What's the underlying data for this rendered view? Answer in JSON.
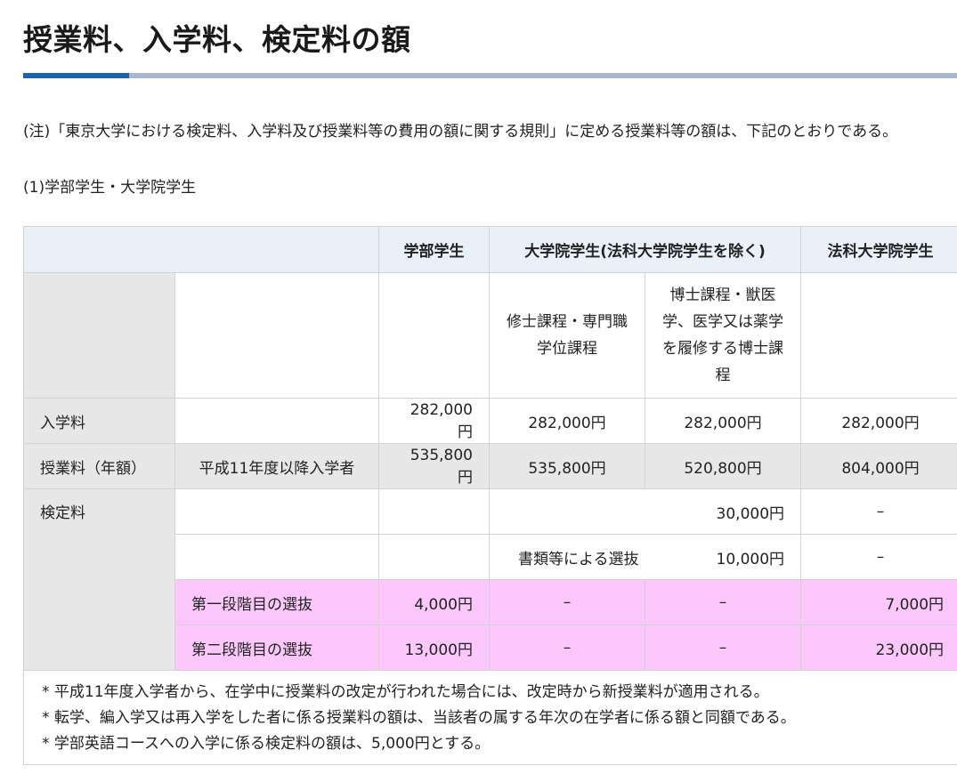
{
  "page": {
    "title": "授業料、入学料、検定料の額",
    "note": "(注)「東京大学における検定料、入学料及び授業料等の費用の額に関する規則」に定める授業料等の額は、下記のとおりである。",
    "section_heading": "(1)学部学生・大学院学生"
  },
  "colors": {
    "accent": "#1f62a6",
    "rule": "#a9b8c9",
    "header_bg": "#e9f0f8",
    "row_header_bg": "#e7e7e7",
    "highlight_bg": "#fcc8fc"
  },
  "table": {
    "headers": {
      "undergrad": "学部学生",
      "grad": "大学院学生(法科大学院学生を除く)",
      "law": "法科大学院学生"
    },
    "subheaders": {
      "masters": "修士課程・専門職学位課程",
      "doctoral": "博士課程・獣医学、医学又は薬学を履修する博士課程"
    },
    "admission": {
      "label": "入学料",
      "undergrad": "282,000円",
      "masters": "282,000円",
      "doctoral": "282,000円",
      "law": "282,000円"
    },
    "tuition": {
      "label": "授業料（年額）",
      "sublabel": "平成11年度以降入学者",
      "undergrad": "535,800円",
      "masters": "535,800円",
      "doctoral": "520,800円",
      "law": "804,000円"
    },
    "exam": {
      "label": "検定料",
      "row1": {
        "grad": "30,000円",
        "law": "–"
      },
      "row2": {
        "grad_label": "書類等による選抜",
        "grad": "10,000円",
        "law": "–"
      },
      "row3": {
        "label": "第一段階目の選抜",
        "undergrad": "4,000円",
        "masters": "–",
        "doctoral": "–",
        "law": "7,000円"
      },
      "row4": {
        "label": "第二段階目の選抜",
        "undergrad": "13,000円",
        "masters": "–",
        "doctoral": "–",
        "law": "23,000円"
      }
    },
    "footnotes": [
      "* 平成11年度入学者から、在学中に授業料の改定が行われた場合には、改定時から新授業料が適用される。",
      "* 転学、編入学又は再入学をした者に係る授業料の額は、当該者の属する年次の在学者に係る額と同額である。",
      "* 学部英語コースへの入学に係る検定料の額は、5,000円とする。"
    ]
  }
}
